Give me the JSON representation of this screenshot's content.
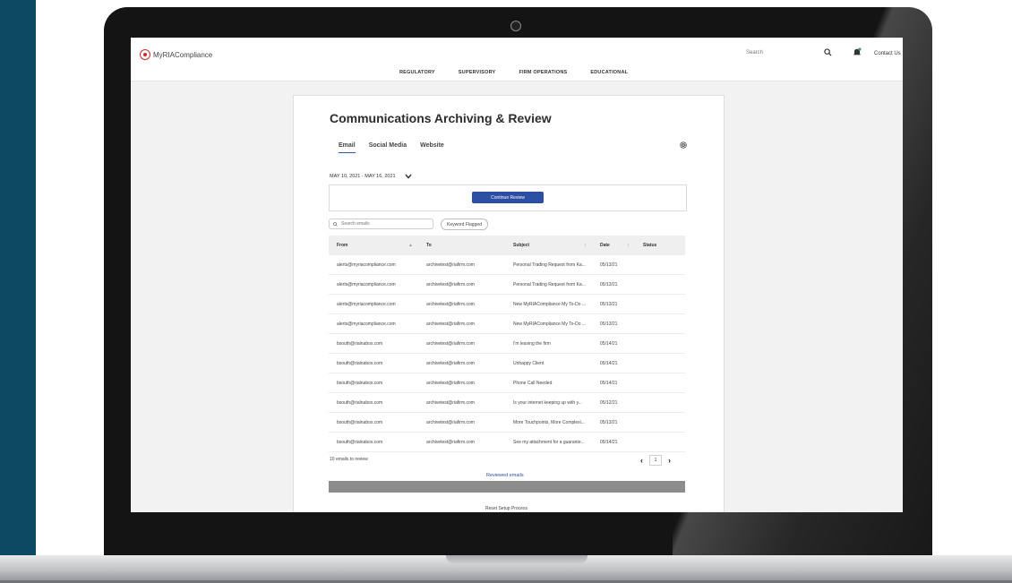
{
  "site": {
    "logo_text": "MyRIACompliance",
    "search_placeholder": "Search",
    "contact_label": "Contact Us",
    "nav": [
      "REGULATORY",
      "SUPERVISORY",
      "FIRM OPERATIONS",
      "EDUCATIONAL"
    ]
  },
  "page": {
    "title": "Communications Archiving & Review",
    "tabs": [
      {
        "label": "Email",
        "active": true
      },
      {
        "label": "Social Media",
        "active": false
      },
      {
        "label": "Website",
        "active": false
      }
    ],
    "date_range": "MAY 10, 2021 - MAY 16, 2021",
    "continue_button": "Continue Review",
    "search_placeholder": "Search emails",
    "filter_chip": "Keyword Flagged"
  },
  "table": {
    "columns": [
      "From",
      "To",
      "Subject",
      "Date",
      "Status"
    ],
    "rows": [
      {
        "from": "alerts@myriacompliance.com",
        "to": "archivetest@riafirm.com",
        "subject": "Personal Trading Request from Ka...",
        "date": "05/13/21",
        "status": ""
      },
      {
        "from": "alerts@myriacompliance.com",
        "to": "archivetest@riafirm.com",
        "subject": "Personal Trading Request from Ka...",
        "date": "05/13/21",
        "status": ""
      },
      {
        "from": "alerts@myriacompliance.com",
        "to": "archivetest@riafirm.com",
        "subject": "New MyRIACompliance My To-Do ...",
        "date": "05/13/21",
        "status": ""
      },
      {
        "from": "alerts@myriacompliance.com",
        "to": "archivetest@riafirm.com",
        "subject": "New MyRIACompliance My To-Do ...",
        "date": "05/13/21",
        "status": ""
      },
      {
        "from": "bsouth@rialnabox.com",
        "to": "archivetest@riafirm.com",
        "subject": "I'm leaving the firm",
        "date": "05/14/21",
        "status": ""
      },
      {
        "from": "bsouth@rialnabox.com",
        "to": "archivetest@riafirm.com",
        "subject": "Unhappy Client",
        "date": "05/14/21",
        "status": ""
      },
      {
        "from": "bsouth@rialnabox.com",
        "to": "archivetest@riafirm.com",
        "subject": "Phone Call Needed",
        "date": "05/14/21",
        "status": ""
      },
      {
        "from": "bsouth@rialnabox.com",
        "to": "archivetest@riafirm.com",
        "subject": "Is your internet keeping up with y...",
        "date": "05/12/21",
        "status": ""
      },
      {
        "from": "bsouth@rialnabox.com",
        "to": "archivetest@riafirm.com",
        "subject": "More Touchpoints, More Complexi...",
        "date": "05/13/21",
        "status": ""
      },
      {
        "from": "bsouth@rialnabox.com",
        "to": "archivetest@riafirm.com",
        "subject": "See my attachment for a guarante...",
        "date": "05/14/21",
        "status": ""
      }
    ],
    "count_text": "10 emails to review",
    "current_page": "1"
  },
  "footer": {
    "reviewed_link": "Reviewed emails",
    "reset_link": "Reset Setup Process"
  },
  "colors": {
    "accent": "#2b4fa3",
    "logo_red": "#c62d2d",
    "left_band": "#0c4a63"
  }
}
